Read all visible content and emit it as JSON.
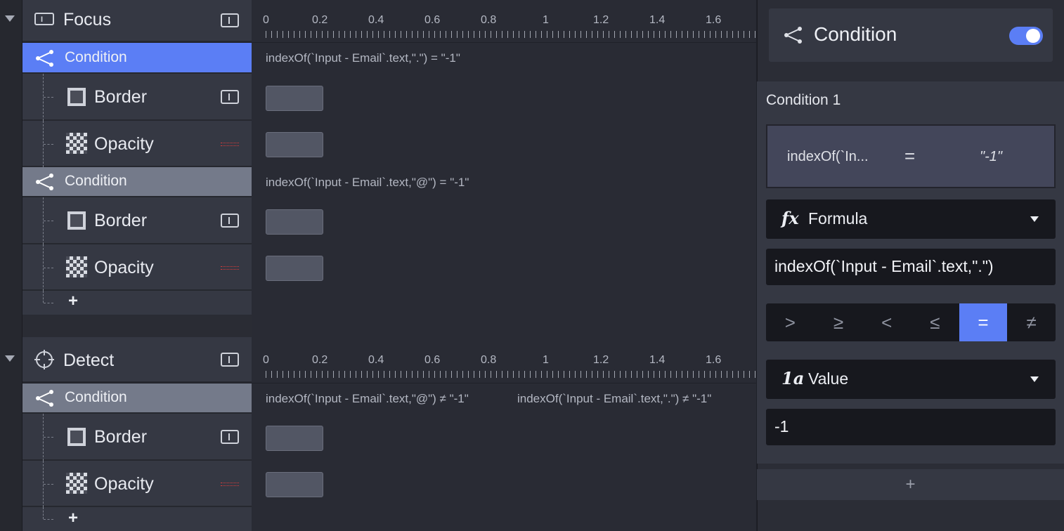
{
  "groups": [
    {
      "title": "Focus",
      "ticks": [
        "0",
        "0.2",
        "0.4",
        "0.6",
        "0.8",
        "1",
        "1.2",
        "1.4",
        "1.6"
      ],
      "conditions": [
        {
          "label": "Condition",
          "expression": "indexOf(`Input - Email`.text,\".\") = \"-1\"",
          "active": true
        },
        {
          "label": "Condition",
          "expression": "indexOf(`Input - Email`.text,\"@\") = \"-1\"",
          "active": false
        }
      ]
    },
    {
      "title": "Detect",
      "ticks": [
        "0",
        "0.2",
        "0.4",
        "0.6",
        "0.8",
        "1",
        "1.2",
        "1.4",
        "1.6"
      ],
      "conditions": [
        {
          "label": "Condition",
          "expression": "indexOf(`Input - Email`.text,\"@\") ≠ \"-1\"",
          "expression2": "indexOf(`Input - Email`.text,\".\") ≠ \"-1\"",
          "active": false
        }
      ]
    }
  ],
  "props": {
    "border": "Border",
    "opacity": "Opacity",
    "add": "+"
  },
  "inspector": {
    "title": "Condition",
    "toggle_on": true,
    "section_label": "Condition",
    "section_number": "1",
    "summary_left": "indexOf(`In...",
    "summary_op": "=",
    "summary_right": "\"-1\"",
    "formula_type_icon": "fx",
    "formula_type_label": "Formula",
    "formula_text": "indexOf(`Input - Email`.text,\".\")",
    "operators": [
      ">",
      "≥",
      "<",
      "≤",
      "=",
      "≠"
    ],
    "selected_operator": "=",
    "value_type_icon": "1a",
    "value_type_label": "Value",
    "value_text": "-1",
    "add_label": "+"
  },
  "colors": {
    "accent": "#5b7ef5"
  }
}
